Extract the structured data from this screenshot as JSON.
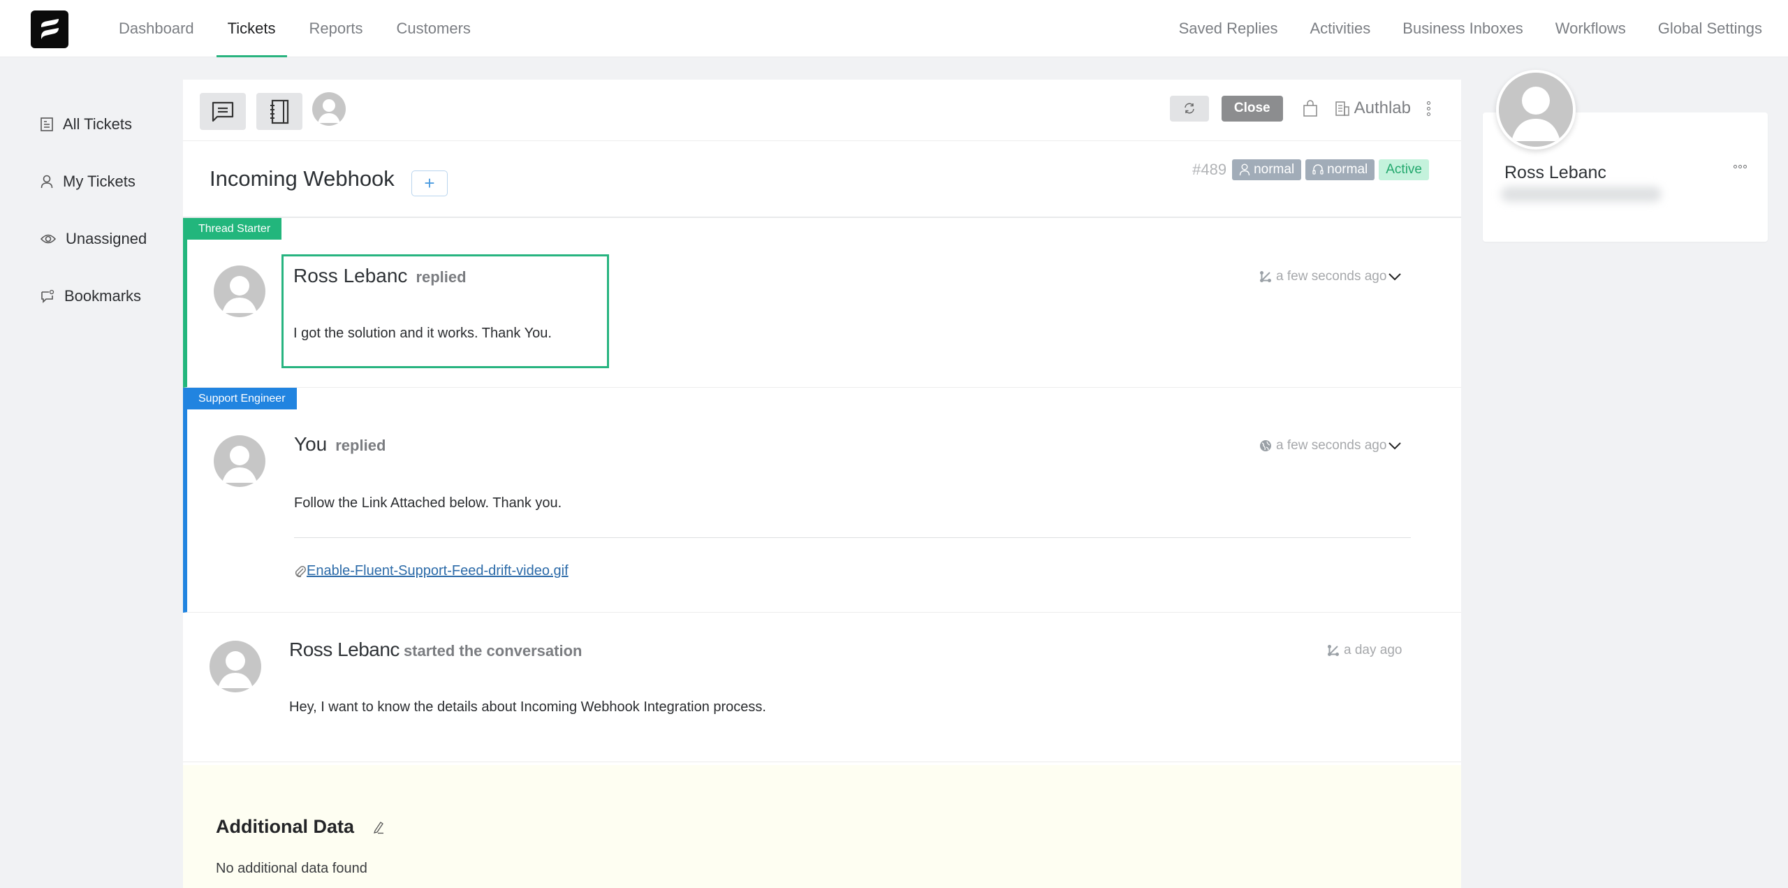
{
  "topnav": {
    "left": [
      {
        "label": "Dashboard",
        "active": false
      },
      {
        "label": "Tickets",
        "active": true
      },
      {
        "label": "Reports",
        "active": false
      },
      {
        "label": "Customers",
        "active": false
      }
    ],
    "right": [
      {
        "label": "Saved Replies"
      },
      {
        "label": "Activities"
      },
      {
        "label": "Business Inboxes"
      },
      {
        "label": "Workflows"
      },
      {
        "label": "Global Settings"
      }
    ]
  },
  "sidebar": {
    "items": [
      {
        "label": "All Tickets",
        "icon": "document-icon"
      },
      {
        "label": "My Tickets",
        "icon": "user-icon"
      },
      {
        "label": "Unassigned",
        "icon": "eye-icon"
      },
      {
        "label": "Bookmarks",
        "icon": "chat-mention-icon"
      }
    ]
  },
  "toolbar": {
    "close_label": "Close",
    "company": "Authlab"
  },
  "ticket": {
    "title": "Incoming Webhook",
    "add_label": "+",
    "id": "#489",
    "client_priority": "normal",
    "agent_priority": "normal",
    "status": "Active",
    "colors": {
      "active_bg": "#c4f2dc",
      "active_text": "#22a86d",
      "badge_gray": "#a1acb8"
    }
  },
  "threads": [
    {
      "tag": "Thread Starter",
      "tag_color": "#22b67c",
      "author": "Ross Lebanc",
      "action": "replied",
      "time": "a few seconds ago",
      "body": "I got the solution and it works. Thank You."
    },
    {
      "tag": "Support Engineer",
      "tag_color": "#2184e0",
      "author": "You",
      "action": "replied",
      "time": "a few seconds ago",
      "body": "Follow the Link Attached below. Thank you.",
      "attachment": "Enable-Fluent-Support-Feed-drift-video.gif"
    },
    {
      "author": "Ross Lebanc",
      "action": "started the conversation",
      "time": "a day ago",
      "body": "Hey, I want to know the details about Incoming Webhook Integration process."
    }
  ],
  "additional_data": {
    "title": "Additional Data",
    "empty": "No additional data found"
  },
  "customer": {
    "name": "Ross Lebanc"
  }
}
